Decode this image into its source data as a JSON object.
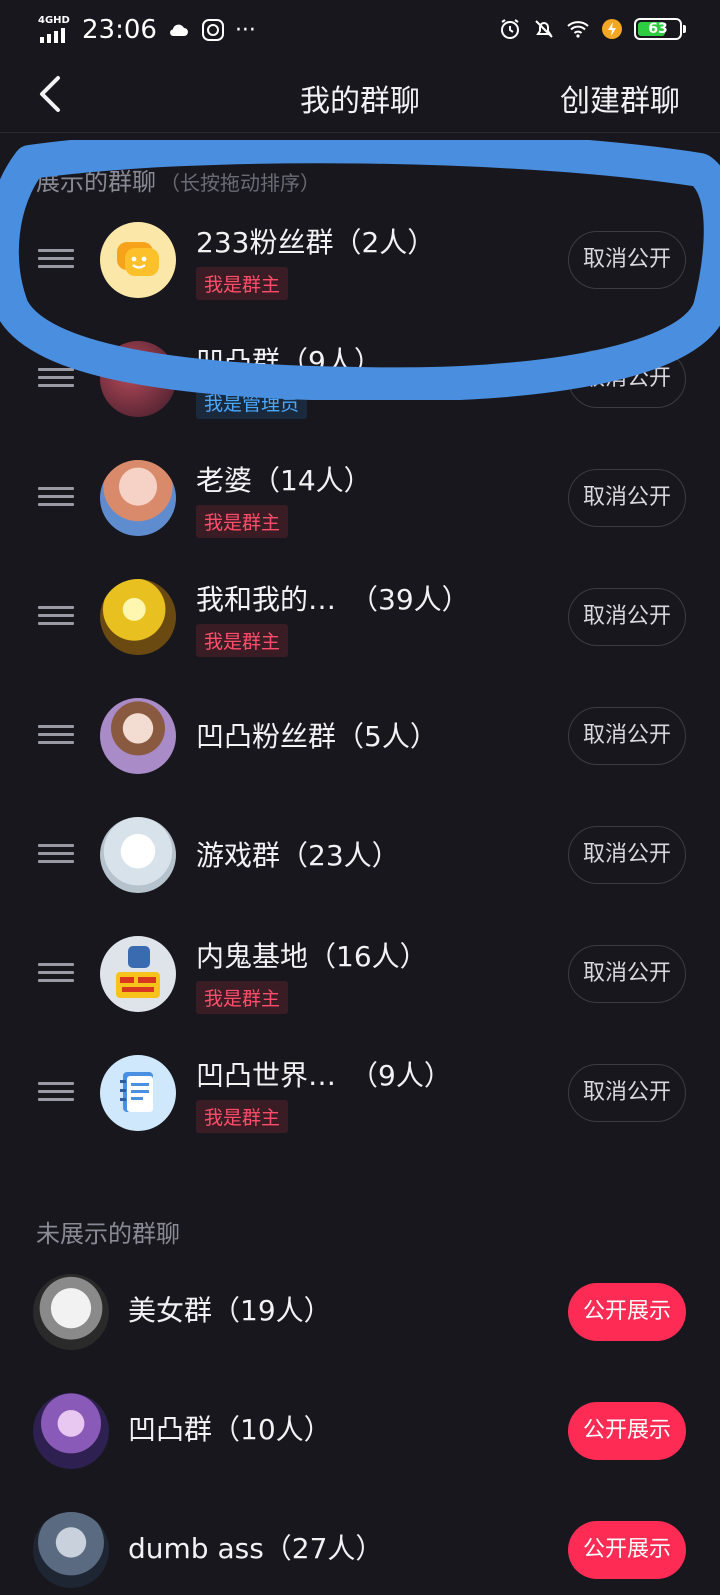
{
  "status_bar": {
    "network": "4GHD",
    "time": "23:06",
    "more": "···",
    "battery": "63"
  },
  "nav": {
    "title": "我的群聊",
    "action": "创建群聊"
  },
  "shown_section": {
    "title": "展示的群聊",
    "hint": "（长按拖动排序）"
  },
  "hidden_section": {
    "title": "未展示的群聊"
  },
  "shown_groups": [
    {
      "name": "233粉丝群（2人）",
      "badge": "我是群主",
      "button": "取消公开",
      "avatar": "chat-bubble-avatar"
    },
    {
      "name": "凹凸群（9人）",
      "badge": "我是管理员",
      "button": "取消公开",
      "avatar": "anime-avatar"
    },
    {
      "name": "老婆（14人）",
      "badge": "我是群主",
      "button": "取消公开",
      "avatar": "anime-avatar"
    },
    {
      "name": "我和我的…　（39人）",
      "badge": "我是群主",
      "button": "取消公开",
      "avatar": "anime-avatar"
    },
    {
      "name": "凹凸粉丝群（5人）",
      "badge": "",
      "button": "取消公开",
      "avatar": "anime-avatar"
    },
    {
      "name": "游戏群（23人）",
      "badge": "",
      "button": "取消公开",
      "avatar": "sketch-avatar"
    },
    {
      "name": "内鬼基地（16人）",
      "badge": "我是群主",
      "button": "取消公开",
      "avatar": "sticker-avatar"
    },
    {
      "name": "凹凸世界…　（9人）",
      "badge": "我是群主",
      "button": "取消公开",
      "avatar": "notes-avatar"
    }
  ],
  "hidden_groups": [
    {
      "name": "美女群（19人）",
      "button": "公开展示"
    },
    {
      "name": "凹凸群（10人）",
      "button": "公开展示"
    },
    {
      "name": "dumb ass（27人）",
      "button": "公开展示"
    }
  ],
  "colors": {
    "background": "#17171d",
    "accent": "#fe2c55",
    "owner_badge": "#ff4d6a",
    "admin_badge": "#4aa8ff",
    "highlight_scribble": "#4a8ee0"
  }
}
